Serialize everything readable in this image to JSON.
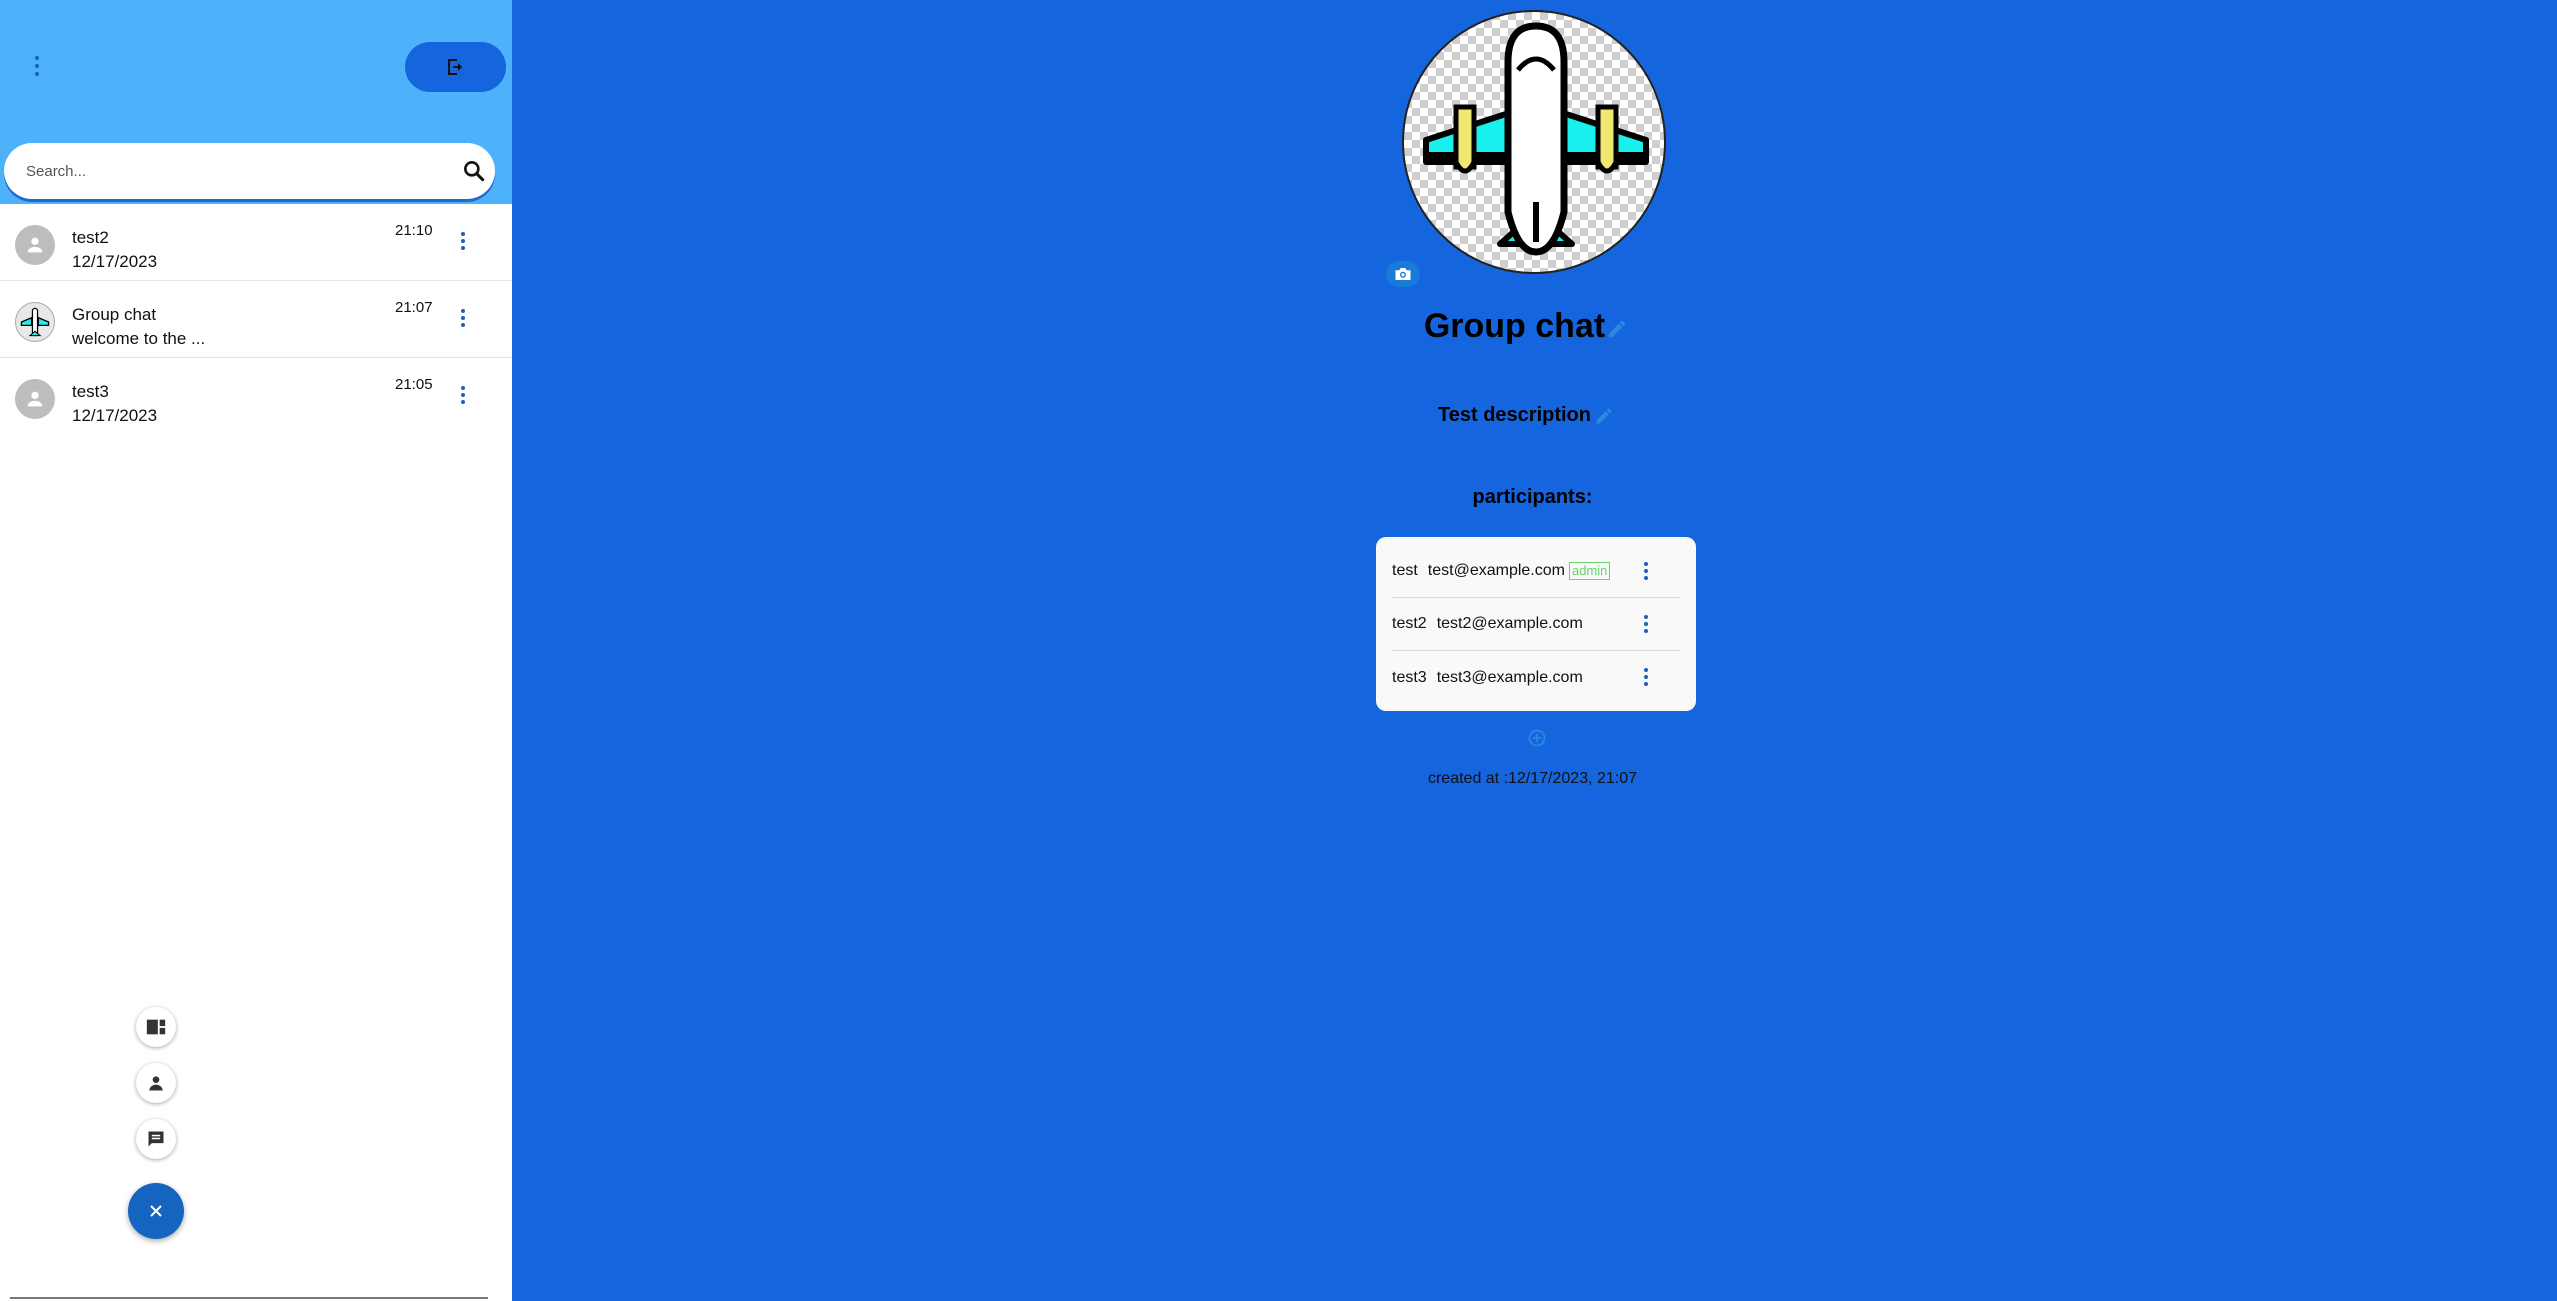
{
  "sidebar": {
    "search": {
      "placeholder": "Search..."
    },
    "chats": [
      {
        "name": "test2",
        "subtitle": "12/17/2023",
        "time": "21:10",
        "avatar_icon": "person-icon"
      },
      {
        "name": "Group chat",
        "subtitle": "welcome to the ...",
        "time": "21:07",
        "avatar_icon": "airplane-icon"
      },
      {
        "name": "test3",
        "subtitle": "12/17/2023",
        "time": "21:05",
        "avatar_icon": "person-icon"
      }
    ],
    "fab_icons": [
      "dashboard-icon",
      "person-icon",
      "chat-icon",
      "close-icon"
    ]
  },
  "main": {
    "group_title": "Group chat",
    "description": "Test description",
    "participants_label": "participants:",
    "participants": [
      {
        "name": "test",
        "email": "test@example.com",
        "badge": "admin"
      },
      {
        "name": "test2",
        "email": "test2@example.com",
        "badge": ""
      },
      {
        "name": "test3",
        "email": "test3@example.com",
        "badge": ""
      }
    ],
    "created_at": "created at :12/17/2023, 21:07"
  },
  "colors": {
    "main_bg": "#1565df",
    "sidebar_header": "#4db2fa",
    "accent": "#1565c0",
    "admin_badge": "#6ad16a"
  }
}
